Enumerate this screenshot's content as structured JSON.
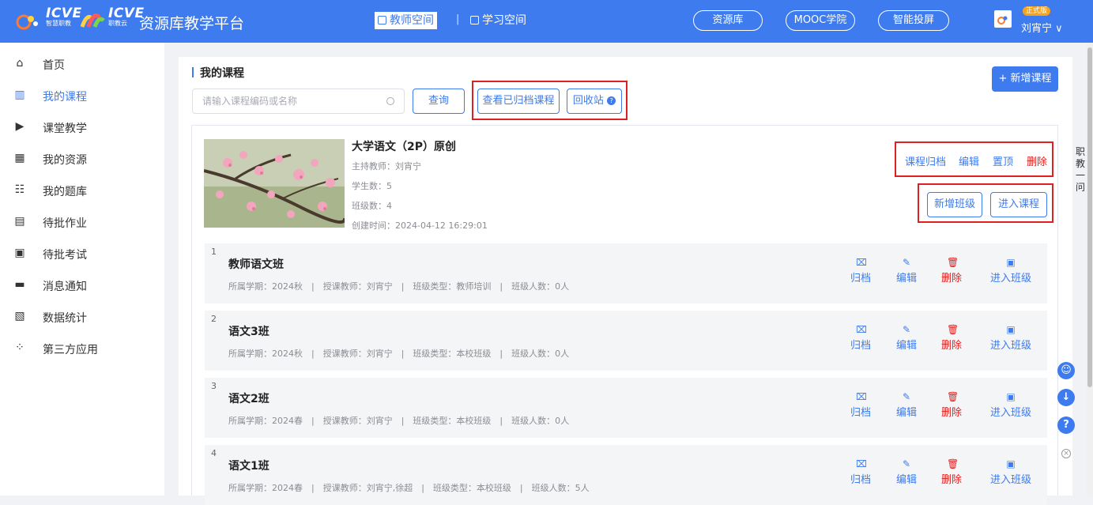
{
  "header": {
    "logo1_text": "ICVE",
    "logo1_sub": "智慧职教",
    "logo2_text": "ICVE",
    "logo2_sub": "职教云",
    "platform_title": "资源库教学平台",
    "spaces": [
      {
        "label": "教师空间",
        "active": true
      },
      {
        "label": "学习空间",
        "active": false
      }
    ],
    "separator": "|",
    "nav_pills": [
      "资源库",
      "MOOC学院",
      "智能投屏"
    ],
    "badge": "正式版",
    "user": "刘宵宁 ∨",
    "brand_color": "#3d7bee"
  },
  "sidebar": {
    "items": [
      {
        "label": "首页",
        "icon": "home-icon",
        "glyph": "⌂"
      },
      {
        "label": "我的课程",
        "icon": "book-icon",
        "glyph": "▥",
        "active": true
      },
      {
        "label": "课堂教学",
        "icon": "screen-play-icon",
        "glyph": "▶"
      },
      {
        "label": "我的资源",
        "icon": "library-icon",
        "glyph": "▦"
      },
      {
        "label": "我的题库",
        "icon": "question-bank-icon",
        "glyph": "☷"
      },
      {
        "label": "待批作业",
        "icon": "homework-icon",
        "glyph": "▤"
      },
      {
        "label": "待批考试",
        "icon": "exam-icon",
        "glyph": "▣"
      },
      {
        "label": "消息通知",
        "icon": "message-icon",
        "glyph": "▬"
      },
      {
        "label": "数据统计",
        "icon": "statistics-icon",
        "glyph": "▧"
      },
      {
        "label": "第三方应用",
        "icon": "apps-icon",
        "glyph": "⁘"
      }
    ]
  },
  "main": {
    "section_title": "我的课程",
    "search_placeholder": "请输入课程编码或名称",
    "query_button": "查询",
    "archived_button": "查看已归档课程",
    "recycle_button": "回收站",
    "new_course_button": "+ 新增课程",
    "course": {
      "name": "大学语文（2P）原创",
      "teacher": "主持教师：刘宵宁",
      "students": "学生数：5",
      "classes": "班级数：4",
      "created": "创建时间：2024-04-12 16:29:01",
      "actions": [
        "课程归档",
        "编辑",
        "置顶",
        "删除"
      ],
      "add_class_button": "新增班级",
      "enter_course_button": "进入课程"
    },
    "class_actions": [
      "归档",
      "编辑",
      "删除",
      "进入班级"
    ],
    "classes": [
      {
        "num": "1",
        "name": "教师语文班",
        "meta": "所属学期：2024秋　|　授课教师：刘宵宁　|　班级类型：教师培训　|　班级人数：0人"
      },
      {
        "num": "2",
        "name": "语文3班",
        "meta": "所属学期：2024秋　|　授课教师：刘宵宁　|　班级类型：本校班级　|　班级人数：0人"
      },
      {
        "num": "3",
        "name": "语文2班",
        "meta": "所属学期：2024春　|　授课教师：刘宵宁　|　班级类型：本校班级　|　班级人数：0人"
      },
      {
        "num": "4",
        "name": "语文1班",
        "meta": "所属学期：2024春　|　授课教师：刘宵宁,徐超　|　班级类型：本校班级　|　班级人数：5人"
      }
    ]
  },
  "side_text": "职教一问",
  "float_icons": [
    "customer-service-icon",
    "download-icon",
    "help-icon"
  ]
}
